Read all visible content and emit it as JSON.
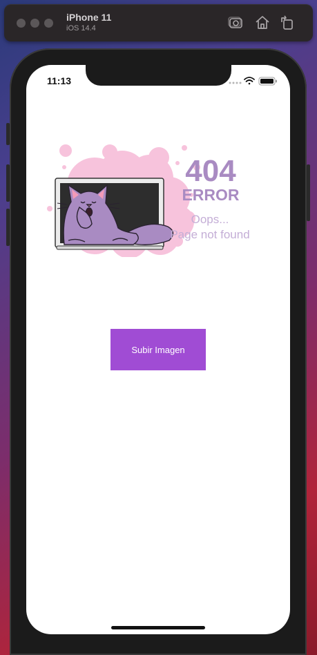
{
  "simulator": {
    "device_name": "iPhone 11",
    "os_version": "iOS 14.4",
    "toolbar_icons": [
      "screenshot-icon",
      "home-icon",
      "rotate-icon"
    ]
  },
  "status_bar": {
    "time": "11:13",
    "icons": [
      "cellular-signal-icon",
      "wifi-icon",
      "battery-icon"
    ]
  },
  "error_illustration": {
    "code": "404",
    "label": "ERROR",
    "message_line1": "Oops...",
    "message_line2": "Page not found",
    "image": "cat-in-laptop-illustration"
  },
  "actions": {
    "upload_button_label": "Subir Imagen"
  },
  "colors": {
    "button": "#a04cd4",
    "error_text": "#a98bc2",
    "blob": "#f7c3dc",
    "cat": "#a98bc2"
  }
}
